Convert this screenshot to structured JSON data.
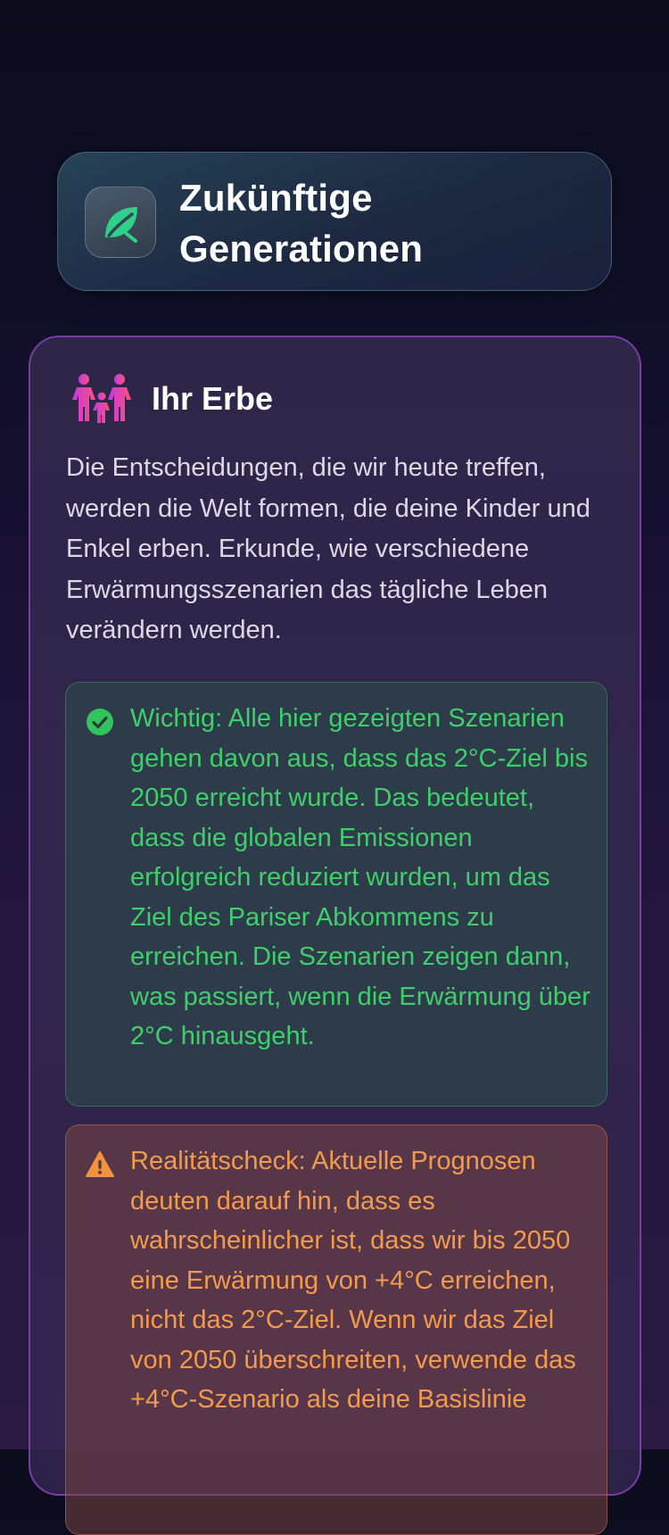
{
  "header": {
    "app_icon": "leaf-icon",
    "title": "Zukünftige Generationen",
    "accent_color": "#2fd08a"
  },
  "legacy_section": {
    "icon": "family-icon",
    "title": "Ihr Erbe",
    "intro": "Die Entscheidungen, die wir heute treffen, werden die Welt formen, die deine Kinder und Enkel erben. Erkunde, wie verschiedene Erwärmungsszenarien das tägliche Leben verändern werden.",
    "important_note": {
      "icon": "check-circle-icon",
      "color": "#3fcf6a",
      "text": "Wichtig: Alle hier gezeigten Szenarien gehen davon aus, dass das 2°C-Ziel bis 2050 erreicht wurde. Das bedeutet, dass die globalen Emissionen erfolgreich reduziert wurden, um das Ziel des Pariser Abkommens zu erreichen. Die Szenarien zeigen dann, was passiert, wenn die Erwärmung über 2°C hinausgeht."
    },
    "reality_check": {
      "icon": "warning-triangle-icon",
      "color": "#f39a4c",
      "text": "Realitätscheck: Aktuelle Prognosen deuten darauf hin, dass es wahrscheinlicher ist, dass wir bis 2050 eine Erwärmung von +4°C erreichen, nicht das 2°C-Ziel. Wenn wir das Ziel von 2050 überschreiten, verwende das +4°C-Szenario als deine Basislinie"
    }
  }
}
